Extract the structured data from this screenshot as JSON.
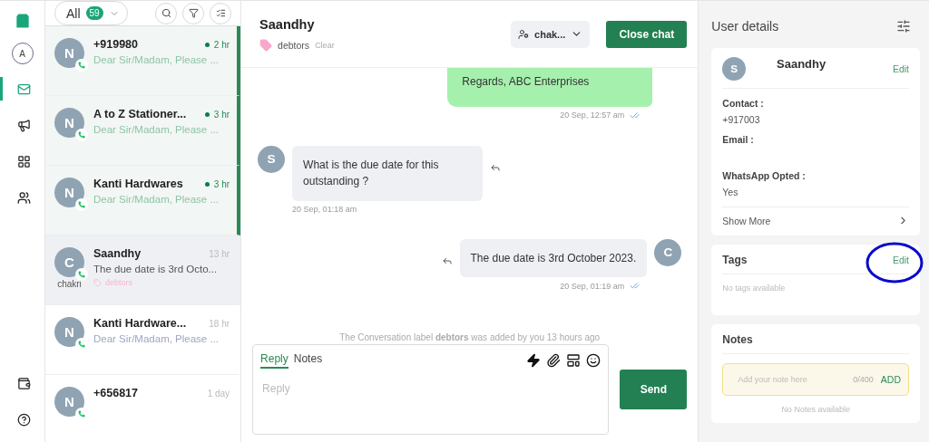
{
  "rail": {
    "avatar": "A",
    "items": [
      {
        "selected": true
      },
      {
        "selected": false
      },
      {
        "selected": false
      },
      {
        "selected": false
      }
    ]
  },
  "list": {
    "filter": "All",
    "count": "59",
    "conversations": [
      {
        "avatar": "N",
        "name": "+919980",
        "preview": "Dear Sir/Madam, Please ...",
        "time": "2 hr",
        "unread": true,
        "selected": false
      },
      {
        "avatar": "N",
        "name": "A to Z Stationer...",
        "preview": "Dear Sir/Madam, Please ...",
        "time": "3 hr",
        "unread": true,
        "selected": false
      },
      {
        "avatar": "N",
        "name": "Kanti Hardwares",
        "preview": "Dear Sir/Madam, Please ...",
        "time": "3 hr",
        "unread": true,
        "selected": false
      },
      {
        "avatar": "C",
        "name": "Saandhy",
        "preview": "The due date is 3rd Octo...",
        "time": "13 hr",
        "unread": false,
        "selected": true,
        "agent": "chakri",
        "tag": "debtors"
      },
      {
        "avatar": "N",
        "name": "Kanti Hardware...",
        "preview": "Dear Sir/Madam, Please ...",
        "time": "18 hr",
        "unread": false,
        "selected": false
      },
      {
        "avatar": "N",
        "name": "+656817",
        "time": "1 day",
        "unread": false,
        "selected": false
      }
    ]
  },
  "chat": {
    "title": "Saandhy",
    "tag": "debtors",
    "clear": "Clear",
    "assignee": "chak...",
    "close": "Close chat",
    "messages": [
      {
        "kind": "outgoing-green",
        "text": "Regards, ABC Enterprises",
        "time": "20 Sep, 12:57 am"
      },
      {
        "kind": "incoming",
        "avatar": "S",
        "text": "What is the due date for this outstanding ?",
        "time": "20 Sep, 01:18 am"
      },
      {
        "kind": "outgoing",
        "avatar": "C",
        "text": "The due date is 3rd October 2023.",
        "time": "20 Sep, 01:19 am"
      },
      {
        "kind": "event",
        "text": "The Conversation label **debtors** was added by you 13 hours ago"
      }
    ],
    "composer": {
      "tabs": [
        {
          "label": "Reply",
          "selected": true
        },
        {
          "label": "Notes",
          "selected": false
        }
      ],
      "placeholder": "Reply",
      "send": "Send"
    }
  },
  "details": {
    "title": "User details",
    "name": "Saandhy",
    "avatar": "S",
    "edit": "Edit",
    "fields": [
      {
        "label": "Contact :",
        "value": "+917003"
      },
      {
        "label": "Email :"
      },
      {
        "label": "WhatsApp Opted :",
        "value": "Yes"
      }
    ],
    "show_more": "Show More",
    "tags": {
      "title": "Tags",
      "edit": "Edit",
      "empty": "No tags available"
    },
    "notes": {
      "title": "Notes",
      "placeholder": "Add your note here",
      "counter": "0/400",
      "add": "ADD",
      "empty": "No Notes available"
    }
  }
}
